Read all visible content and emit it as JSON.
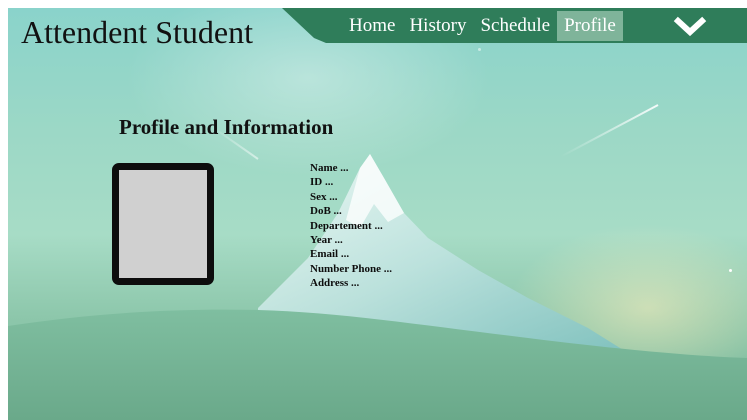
{
  "app": {
    "title": "Attendent Student"
  },
  "nav": {
    "items": [
      {
        "label": "Home",
        "active": false
      },
      {
        "label": "History",
        "active": false
      },
      {
        "label": "Schedule",
        "active": false
      },
      {
        "label": "Profile",
        "active": true
      }
    ],
    "menu_icon": "chevron-down-icon"
  },
  "profile": {
    "heading": "Profile and Information",
    "photo_icon": "photo-placeholder",
    "fields": [
      "Name ...",
      "ID ...",
      "Sex ...",
      "DoB ...",
      "Departement ...",
      "Year ...",
      "Email ...",
      "Number Phone ...",
      "Address ..."
    ]
  },
  "colors": {
    "nav_bar": "#2f7d5a",
    "nav_active": "#7fb49a",
    "page_tint": "#9cd8c6",
    "photo_frame": "#0d0d0d",
    "photo_fill": "#d0d0d0"
  }
}
